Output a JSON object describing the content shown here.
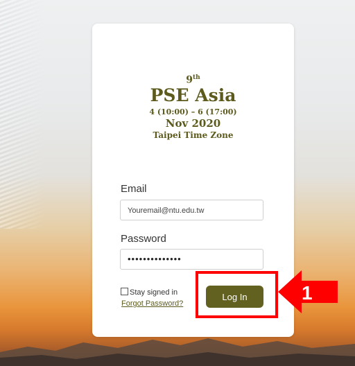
{
  "logo": {
    "ordinal": "9",
    "ordinal_suffix": "th",
    "event_name": "PSE Asia",
    "dates": "4 (10:00) – 6 (17:00)",
    "month_year": "Nov 2020",
    "timezone": "Taipei Time Zone"
  },
  "form": {
    "email_label": "Email",
    "email_value": "Youremail@ntu.edu.tw",
    "password_label": "Password",
    "password_value": "••••••••••••••",
    "stay_signed_in_label": "Stay signed in",
    "stay_signed_in_checked": false,
    "forgot_password_label": "Forgot Password?",
    "login_button_label": "Log In"
  },
  "annotation": {
    "step_number": "1",
    "color": "#ff0000"
  },
  "colors": {
    "accent": "#62611f",
    "logo_text": "#5c5a1c"
  }
}
